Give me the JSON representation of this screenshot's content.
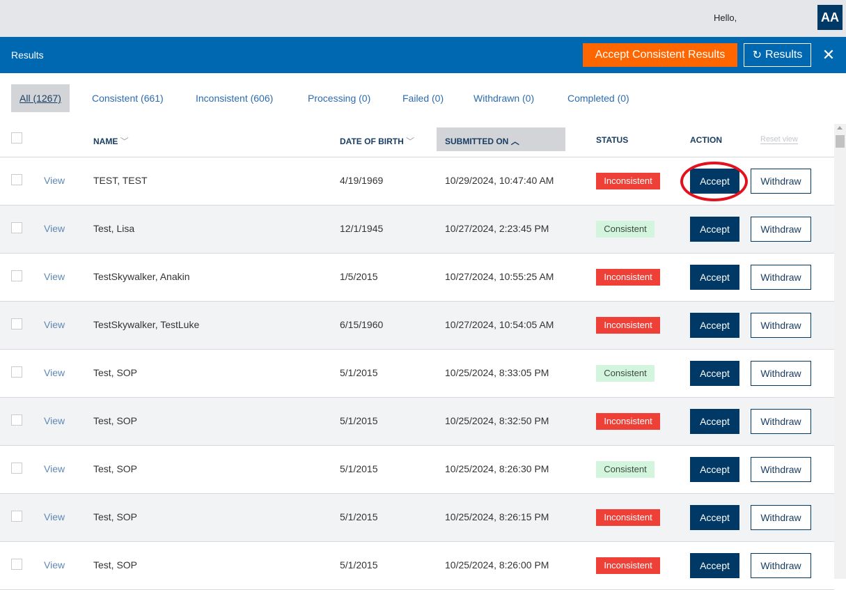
{
  "header": {
    "greeting": "Hello,",
    "avatar_initials": "AA"
  },
  "toolbar": {
    "title": "Results",
    "accept_consistent_label": "Accept Consistent Results",
    "refresh_results_label": "Results",
    "refresh_icon": "↻",
    "close_icon": "✕"
  },
  "tabs": [
    {
      "label": "All (1267)",
      "active": true
    },
    {
      "label": "Consistent (661)"
    },
    {
      "label": "Inconsistent (606)"
    },
    {
      "label": "Processing (0)"
    },
    {
      "label": "Failed (0)"
    },
    {
      "label": "Withdrawn (0)"
    },
    {
      "label": "Completed (0)"
    }
  ],
  "table": {
    "columns": {
      "name": "NAME",
      "dob": "DATE OF BIRTH",
      "submitted": "SUBMITTED ON",
      "status": "STATUS",
      "action": "ACTION",
      "reset": "Reset view",
      "sort_down_icon": "﹀",
      "sort_up_icon": "︿"
    },
    "view_label": "View",
    "accept_label": "Accept",
    "withdraw_label": "Withdraw",
    "rows": [
      {
        "name": "TEST,  TEST",
        "dob": "4/19/1969",
        "submitted": "10/29/2024, 10:47:40 AM",
        "status": "Inconsistent"
      },
      {
        "name": "Test,  Lisa",
        "dob": "12/1/1945",
        "submitted": "10/27/2024, 2:23:45 PM",
        "status": "Consistent"
      },
      {
        "name": "TestSkywalker,  Anakin",
        "dob": "1/5/2015",
        "submitted": "10/27/2024, 10:55:25 AM",
        "status": "Inconsistent"
      },
      {
        "name": "TestSkywalker,  TestLuke",
        "dob": "6/15/1960",
        "submitted": "10/27/2024, 10:54:05 AM",
        "status": "Inconsistent"
      },
      {
        "name": "Test,  SOP",
        "dob": "5/1/2015",
        "submitted": "10/25/2024, 8:33:05 PM",
        "status": "Consistent"
      },
      {
        "name": "Test,  SOP",
        "dob": "5/1/2015",
        "submitted": "10/25/2024, 8:32:50 PM",
        "status": "Inconsistent"
      },
      {
        "name": "Test,  SOP",
        "dob": "5/1/2015",
        "submitted": "10/25/2024, 8:26:30 PM",
        "status": "Consistent"
      },
      {
        "name": "Test,  SOP",
        "dob": "5/1/2015",
        "submitted": "10/25/2024, 8:26:15 PM",
        "status": "Inconsistent"
      },
      {
        "name": "Test,  SOP",
        "dob": "5/1/2015",
        "submitted": "10/25/2024, 8:26:00 PM",
        "status": "Inconsistent"
      }
    ]
  },
  "colors": {
    "brand_blue": "#0067b1",
    "navy": "#013966",
    "orange": "#ff6600",
    "inconsistent": "#ee4036",
    "consistent_bg": "#d4f5dd",
    "annotation_red": "#e3101d"
  }
}
